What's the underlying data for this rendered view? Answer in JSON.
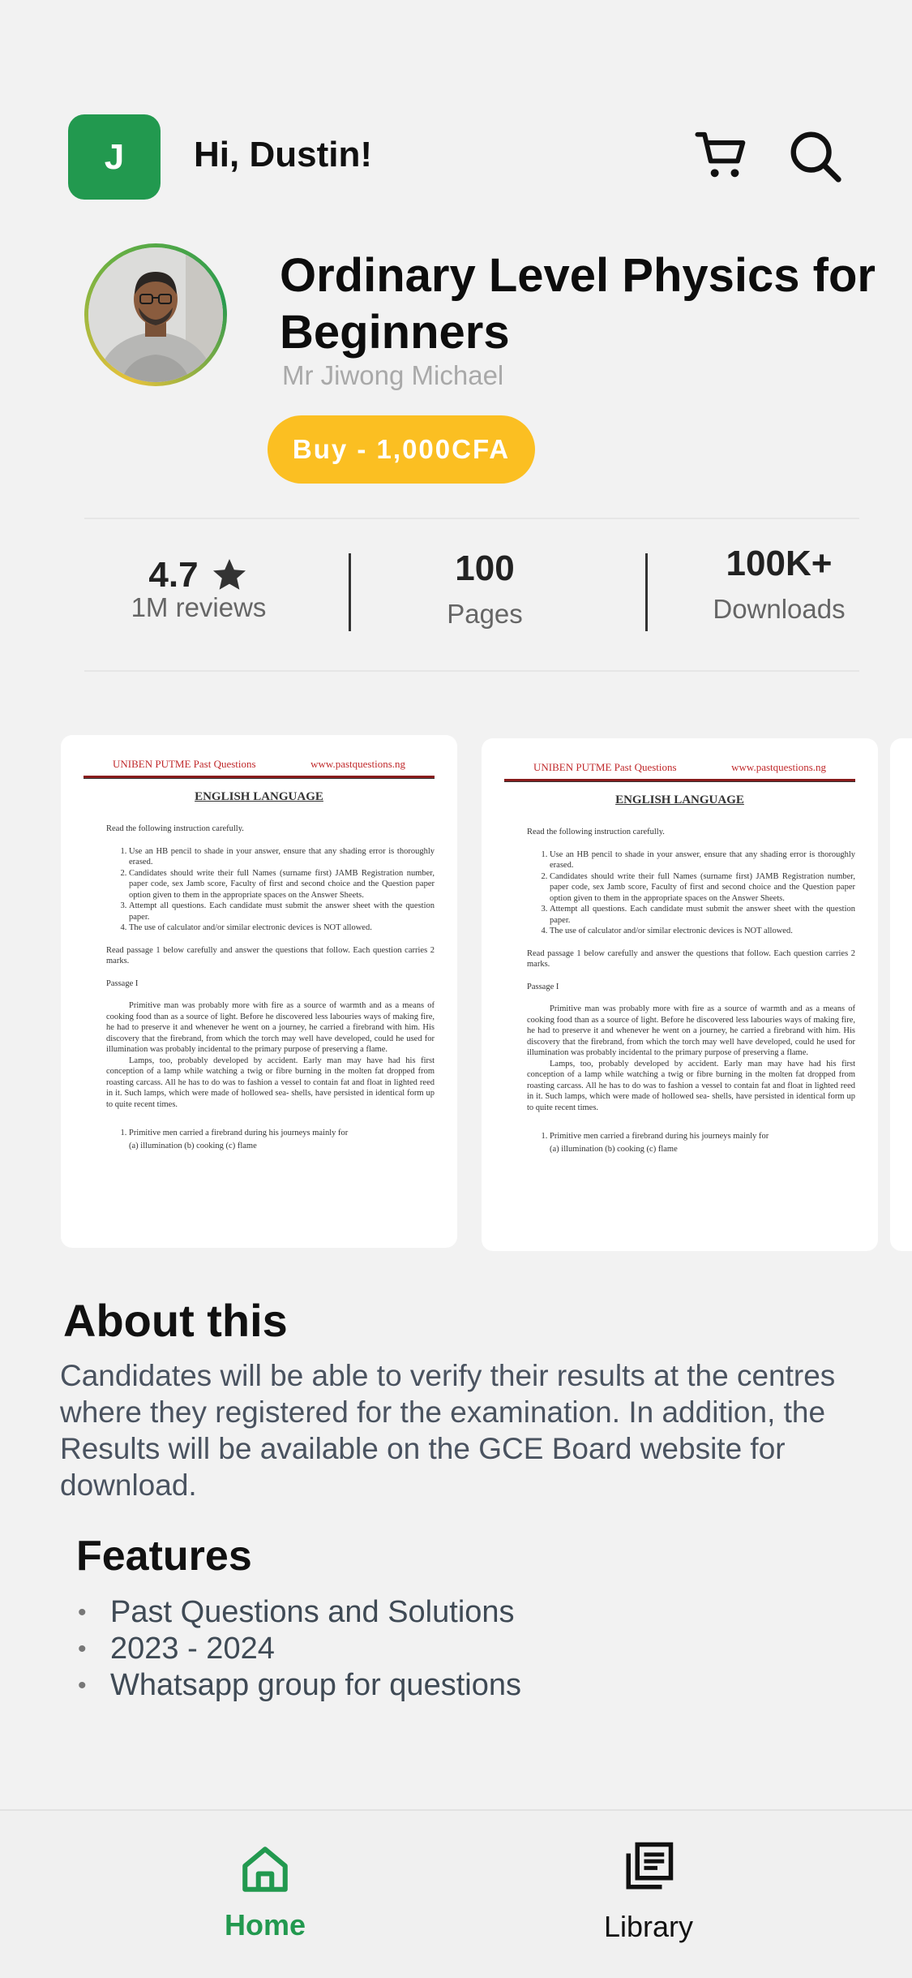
{
  "header": {
    "avatar_letter": "J",
    "greeting": "Hi, Dustin!",
    "cart_icon": "cart-icon",
    "search_icon": "search-icon"
  },
  "book": {
    "title": "Ordinary Level Physics for Beginners",
    "author": "Mr Jiwong Michael",
    "buy_label": "Buy - 1,000CFA"
  },
  "stats": {
    "rating": "4.7",
    "reviews": "1M reviews",
    "pages_value": "100",
    "pages_label": "Pages",
    "downloads_value": "100K+",
    "downloads_label": "Downloads"
  },
  "preview_page": {
    "header_left": "UNIBEN PUTME Past Questions",
    "header_right": "www.pastquestions.ng",
    "title": "ENGLISH LANGUAGE",
    "instruction": "Read the following instruction carefully.",
    "rules": [
      "Use an HB pencil to shade in your answer, ensure that any shading error is thoroughly erased.",
      "Candidates should write their full Names (surname first) JAMB Registration number, paper code, sex Jamb score, Faculty of first and second choice and the Question paper option given to them in the appropriate spaces on the Answer Sheets.",
      "Attempt all questions. Each candidate must submit the answer sheet with the question paper.",
      "The use of calculator and/or similar electronic devices is NOT allowed."
    ],
    "passage_intro": "Read passage 1 below carefully and answer the questions that follow. Each question carries 2 marks.",
    "passage_label": "Passage I",
    "paragraph_1": "Primitive man was probably more with fire as a source of warmth and as a means of cooking food than as a source of light. Before he discovered less labouries ways of making fire, he had to preserve it and whenever he went on a journey, he carried a firebrand with him. His discovery that the firebrand, from which the torch may well have developed, could he used for illumination was probably incidental to the primary purpose of preserving a flame.",
    "paragraph_2": "Lamps, too, probably developed by accident. Early man may have had his first conception of a lamp while watching a twig or fibre burning in the molten fat dropped from roasting carcass. All he has to do was to fashion a vessel to contain fat and float in lighted reed in it. Such lamps, which were made of hollowed sea- shells, have persisted in identical form up to quite recent times.",
    "question": "Primitive men carried a firebrand during his journeys mainly for",
    "options": "(a) illumination (b) cooking (c) flame"
  },
  "about": {
    "title": "About this",
    "body": "Candidates will be able to verify their results at the centres where they registered for the examination. In addition, the Results will be available on the GCE Board website for download."
  },
  "features": {
    "title": "Features",
    "items": [
      "Past Questions and Solutions",
      "2023 - 2024",
      "Whatsapp group for questions"
    ]
  },
  "nav": {
    "home_label": "Home",
    "library_label": "Library"
  },
  "colors": {
    "brand_green": "#22994f",
    "buy_yellow": "#fbbf22",
    "background": "#f2f2f2"
  }
}
